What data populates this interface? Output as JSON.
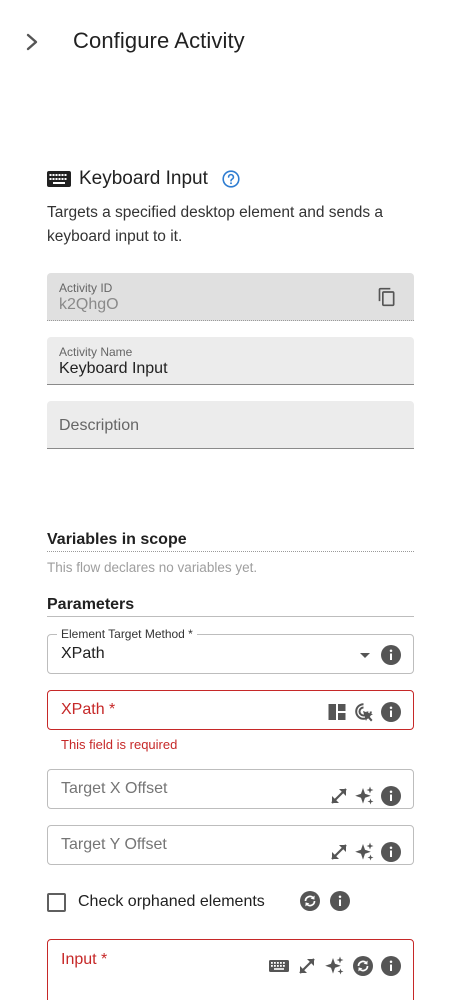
{
  "header": {
    "title": "Configure Activity"
  },
  "activity": {
    "title": "Keyboard Input",
    "description": "Targets a specified desktop element and sends a keyboard input to it."
  },
  "fields": {
    "activity_id": {
      "label": "Activity ID",
      "value": "k2QhgO"
    },
    "activity_name": {
      "label": "Activity Name",
      "value": "Keyboard Input"
    },
    "description": {
      "placeholder": "Description"
    }
  },
  "variables": {
    "title": "Variables in scope",
    "note": "This flow declares no variables yet."
  },
  "parameters": {
    "title": "Parameters",
    "target_method": {
      "label": "Element Target Method *",
      "value": "XPath"
    },
    "xpath": {
      "label": "XPath *",
      "error": "This field is required"
    },
    "x_offset": {
      "label": "Target X Offset"
    },
    "y_offset": {
      "label": "Target Y Offset"
    },
    "orphaned": {
      "label": "Check orphaned elements",
      "checked": false
    },
    "input": {
      "label": "Input *"
    }
  },
  "colors": {
    "error": "#c62828",
    "help": "#2f7dd1",
    "icon": "#555555"
  }
}
